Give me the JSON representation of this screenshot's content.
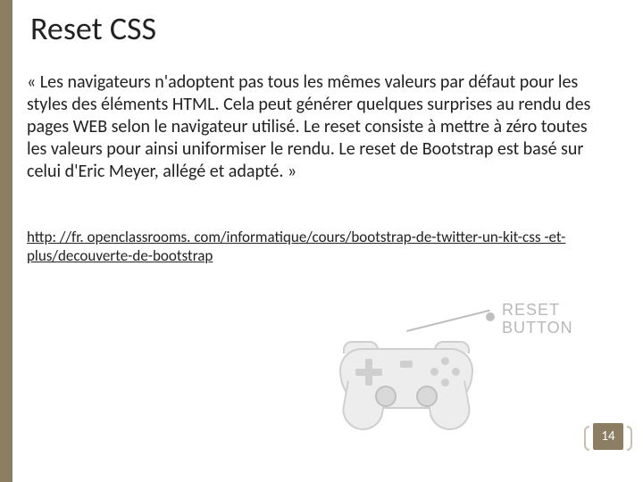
{
  "title": "Reset CSS",
  "paragraph": "« Les navigateurs n'adoptent pas tous les mêmes valeurs par défaut pour les styles des éléments HTML. Cela peut générer quelques surprises au rendu des pages WEB selon le navigateur utilisé. Le reset consiste à mettre à zéro toutes les valeurs pour ainsi uniformiser le rendu. Le reset de Bootstrap est basé sur celui d'Eric Meyer, allégé et adapté. »",
  "link_text": "http: //fr. openclassrooms. com/informatique/cours/bootstrap-de-twitter-un-kit-css -et-plus/decouverte-de-bootstrap",
  "callout": "RESET\nBUTTON",
  "page_number": "14"
}
